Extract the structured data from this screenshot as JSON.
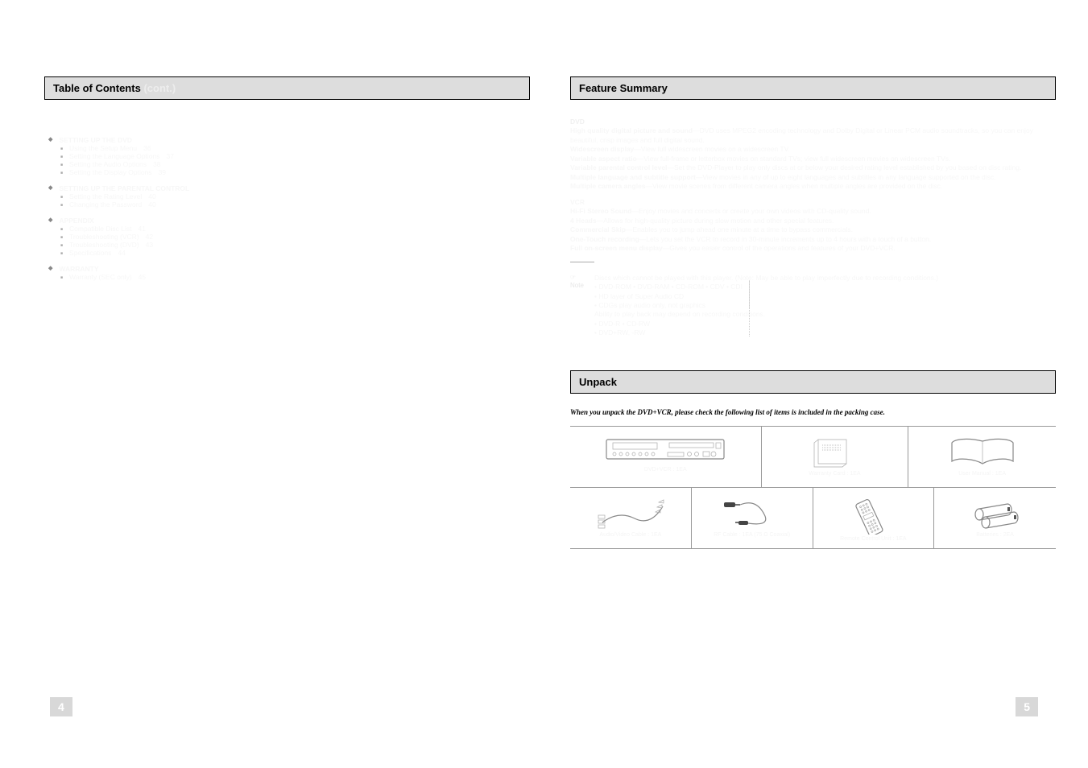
{
  "left": {
    "heading": "Table of Contents",
    "cont_label": "(cont.)",
    "groups": [
      {
        "title": "SETTING UP THE DVD",
        "items": [
          {
            "label": "Using the Setup Menu",
            "page": "36"
          },
          {
            "label": "Setting the Language Options",
            "page": "37"
          },
          {
            "label": "Setting the Audio Options",
            "page": "38"
          },
          {
            "label": "Setting the Display Options",
            "page": "39"
          }
        ]
      },
      {
        "title": "SETTING UP THE PARENTAL CONTROL",
        "items": [
          {
            "label": "Setting the Rating Level",
            "page": "40"
          },
          {
            "label": "Changing the Password",
            "page": "40"
          }
        ]
      },
      {
        "title": "APPENDIX",
        "items": [
          {
            "label": "Compatible Disc List",
            "page": "41"
          },
          {
            "label": "Troubleshooting (VCR)",
            "page": "42"
          },
          {
            "label": "Troubleshooting (DVD)",
            "page": "43"
          },
          {
            "label": "Specifications",
            "page": "44"
          }
        ]
      },
      {
        "title": "WARRANTY",
        "items": [
          {
            "label": "Warranty (SEC only)",
            "page": "45"
          }
        ]
      }
    ]
  },
  "right": {
    "feature_head": "Feature Summary",
    "dvd_title": "DVD",
    "dvd": [
      {
        "k": "High quality digital picture and sound",
        "v": "—DVD uses MPEG2 encoding technology and Dolby Digital or Linear PCM audio soundtracks, so you can enjoy beautiful, crisp images and full digital sound."
      },
      {
        "k": "Widescreen display",
        "v": "—View full widescreen movies on a widescreen TV."
      },
      {
        "k": "Variable aspect ratio",
        "v": "—View full-frame or letterbox movies on standard TVs; view full widescreen movies on widescreen TVs."
      },
      {
        "k": "Variable parental control level",
        "v": "—Set the DVD-Player to play only discs at or below your desired rating level established by you based on disc rating."
      },
      {
        "k": "Multiple language and subtitle support",
        "v": "—View movies in any of up to eight languages and subtitles in any language supported on the disc."
      },
      {
        "k": "Multiple camera angles",
        "v": "—View movie scenes from different camera angles when multiple angles are provided on the disc."
      }
    ],
    "vcr_title": "VCR",
    "vcr": [
      {
        "k": "Hi-Fi Stereo Sound",
        "v": "—Enjoy movies and concerts or create your own videos with CD-quality sound."
      },
      {
        "k": "4 Heads",
        "v": "—Allows for high-quality picture during slow motion and other special features."
      },
      {
        "k": "Commercial Skip",
        "v": "—Enables you to jump ahead one minute at a time to bypass commercials."
      },
      {
        "k": "One-Touch recording",
        "v": "—Lets you set the VCR to record in 30-minute increments up to 4 hours with a touch of a button."
      },
      {
        "k": "Full on-screen menu display",
        "v": "—Gives you easier control of the operations and features of your DVD+VCR."
      }
    ],
    "note_label": "Note",
    "notes": [
      "Discs which cannot be played with this player. (Note: May be able to play imperfectly due to recording conditions.)",
      "• DVD-ROM  • DVD-RAM  • CD-ROM  • CDV  • CDI",
      "• HD layer of Super Audio CD",
      "• CDGs play audio only, not graphics",
      "Ability to play back may depend on recording conditions.",
      "• DVD-R  • CD-RW",
      "• DVD+RW, -RW"
    ],
    "unpack_head": "Unpack",
    "unpack_intro": "When you unpack the DVD+VCR, please check the following list of items is included in the packing case.",
    "cells": {
      "r1c1": "DVD+VCR  :  1EA",
      "r1c2": "Warranty Card  :  1EA",
      "r1c3": "User Manual  :  1EA",
      "r2c1": "Audio/Video Cable  :  1EA",
      "r2c2": "RF Cable  :  1EA (75 Ω Coaxial)",
      "r2c3": "Remote Control Unit  :  1EA",
      "r2c4": "Batteries  :  2EA"
    }
  },
  "pages": {
    "left": "4",
    "right": "5"
  }
}
